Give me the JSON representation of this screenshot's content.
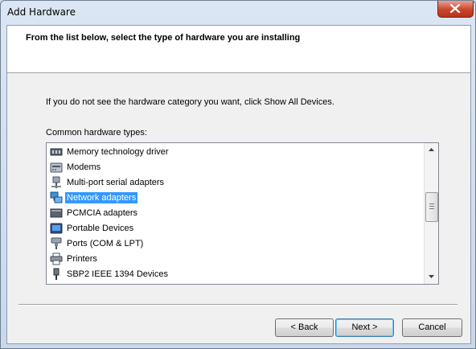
{
  "window": {
    "title": "Add Hardware"
  },
  "header": {
    "instruction": "From the list below, select the type of hardware you are installing"
  },
  "body": {
    "info": "If you do not see the hardware category you want, click Show All Devices.",
    "list_label": "Common hardware types:"
  },
  "list": {
    "items": [
      {
        "label": "Memory technology driver",
        "icon": "memory-chip-icon"
      },
      {
        "label": "Modems",
        "icon": "modem-icon"
      },
      {
        "label": "Multi-port serial adapters",
        "icon": "serial-adapter-icon"
      },
      {
        "label": "Network adapters",
        "icon": "network-adapter-icon",
        "selected": true
      },
      {
        "label": "PCMCIA adapters",
        "icon": "pcmcia-card-icon"
      },
      {
        "label": "Portable Devices",
        "icon": "portable-device-icon"
      },
      {
        "label": "Ports (COM & LPT)",
        "icon": "port-icon"
      },
      {
        "label": "Printers",
        "icon": "printer-icon"
      },
      {
        "label": "SBP2 IEEE 1394 Devices",
        "icon": "ieee1394-icon"
      }
    ]
  },
  "buttons": {
    "back": "< Back",
    "next": "Next >",
    "cancel": "Cancel"
  },
  "colors": {
    "selection": "#3399ff",
    "window_frame": "#cfdcec",
    "close_button": "#c9462c"
  }
}
